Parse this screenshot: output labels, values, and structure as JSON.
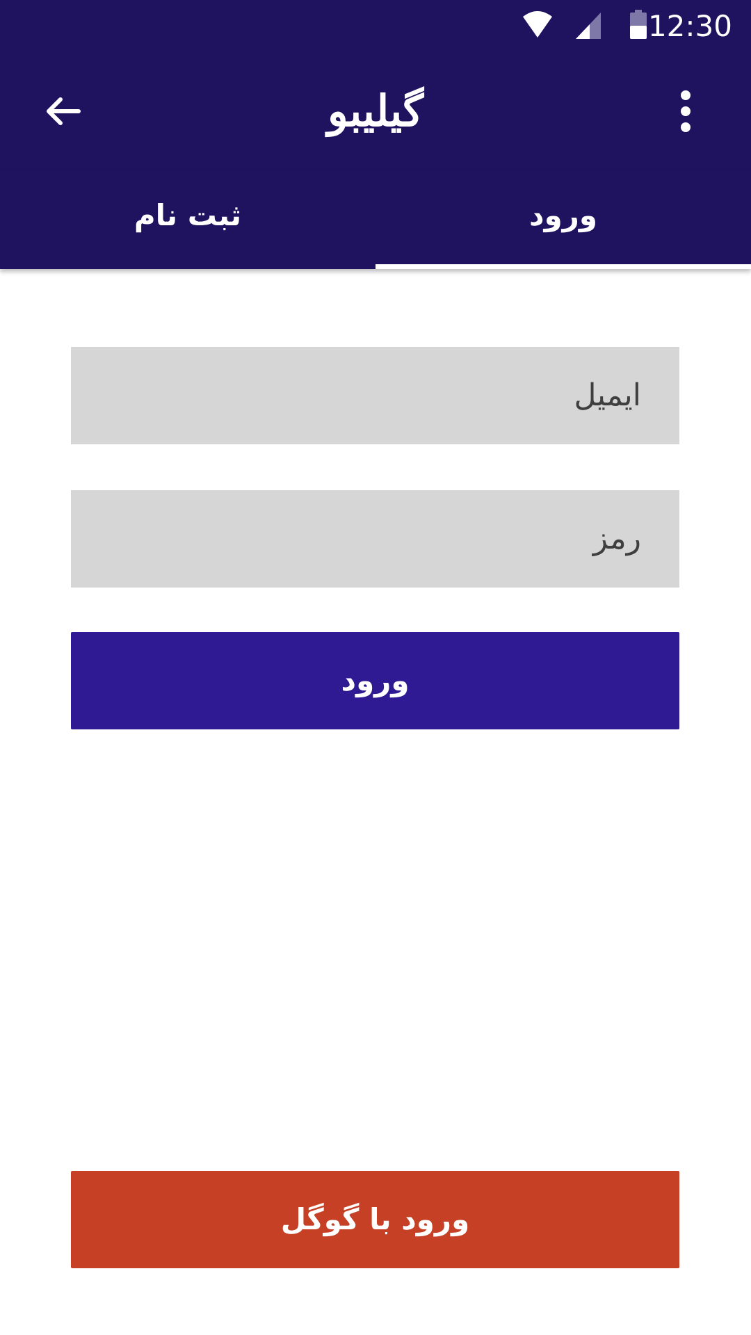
{
  "status_bar": {
    "time": "12:30",
    "icons": [
      "wifi-icon",
      "cellular-signal-icon",
      "battery-icon"
    ]
  },
  "app_bar": {
    "title": "گیلیبو",
    "back_icon": "arrow-back-icon",
    "menu_icon": "more-vert-icon"
  },
  "tabs": [
    {
      "label": "ثبت نام",
      "selected": false
    },
    {
      "label": "ورود",
      "selected": true
    }
  ],
  "form": {
    "email_placeholder": "ایمیل",
    "password_placeholder": "رمز",
    "login_button": "ورود",
    "google_button": "ورود با گوگل"
  },
  "colors": {
    "primary": "#1f1360",
    "button_primary": "#2f1a93",
    "google_button": "#c54025",
    "input_background": "#d6d6d6"
  }
}
